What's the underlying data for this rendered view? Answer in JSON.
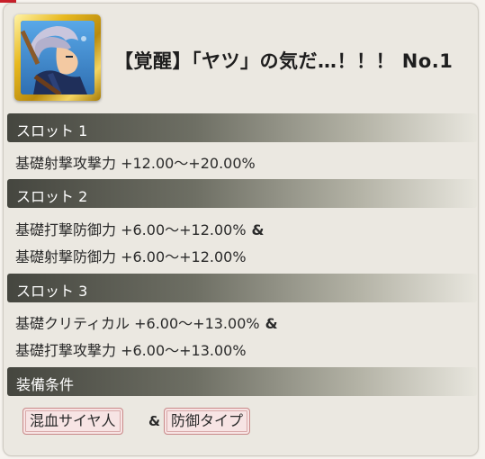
{
  "item": {
    "title": "【覚醒】「ヤツ」の気だ…！！！ No.1",
    "icon": "character-portrait"
  },
  "slots": [
    {
      "label": "スロット 1",
      "effects": [
        "基礎射撃攻撃力 +12.00〜+20.00%"
      ]
    },
    {
      "label": "スロット 2",
      "effects": [
        "基礎打撃防御力 +6.00〜+12.00%",
        "基礎射撃防御力 +6.00〜+12.00%"
      ]
    },
    {
      "label": "スロット 3",
      "effects": [
        "基礎クリティカル +6.00〜+13.00%",
        "基礎打撃攻撃力 +6.00〜+13.00%"
      ]
    }
  ],
  "conjunction": "&",
  "requirements": {
    "label": "装備条件",
    "tags": [
      "混血サイヤ人",
      "防御タイプ"
    ]
  },
  "colors": {
    "bar_dark": "#45463f",
    "card_bg": "#ebe8e1",
    "tag_bg": "#f7e4e4",
    "tag_border": "#c98a8a",
    "frame_gold": "#e8b920"
  }
}
